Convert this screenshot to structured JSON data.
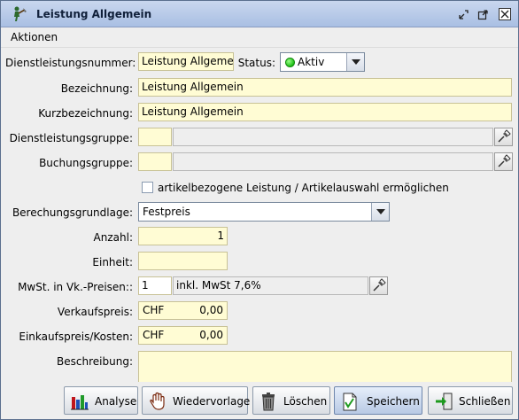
{
  "window": {
    "title": "Leistung Allgemein"
  },
  "menu": {
    "aktionen": "Aktionen"
  },
  "form": {
    "dienstleistungsnummer": {
      "label": "Dienstleistungsnummer:",
      "value": "Leistung Allgemein"
    },
    "status": {
      "label": "Status:",
      "value": "Aktiv"
    },
    "bezeichnung": {
      "label": "Bezeichnung:",
      "value": "Leistung Allgemein"
    },
    "kurzbezeichnung": {
      "label": "Kurzbezeichnung:",
      "value": "Leistung Allgemein"
    },
    "dienstleistungsgruppe": {
      "label": "Dienstleistungsgruppe:",
      "code": "",
      "name": ""
    },
    "buchungsgruppe": {
      "label": "Buchungsgruppe:",
      "code": "",
      "name": ""
    },
    "artikelbezogen": {
      "label": "artikelbezogene Leistung / Artikelauswahl ermöglichen",
      "checked": false
    },
    "berechnungsgrundlage": {
      "label": "Berechungsgrundlage:",
      "value": "Festpreis"
    },
    "anzahl": {
      "label": "Anzahl:",
      "value": "1"
    },
    "einheit": {
      "label": "Einheit:",
      "value": ""
    },
    "mwst": {
      "label": "MwSt. in Vk.-Preisen::",
      "code": "1",
      "name": "inkl. MwSt 7,6%"
    },
    "verkaufspreis": {
      "label": "Verkaufspreis:",
      "currency": "CHF",
      "value": "0,00"
    },
    "einkaufspreis": {
      "label": "Einkaufspreis/Kosten:",
      "currency": "CHF",
      "value": "0,00"
    },
    "beschreibung": {
      "label": "Beschreibung:",
      "value": ""
    }
  },
  "buttons": {
    "analyse": "Analyse",
    "wiedervorlage": "Wiedervorlage",
    "loeschen": "Löschen",
    "speichern": "Speichern",
    "schliessen": "Schließen"
  }
}
